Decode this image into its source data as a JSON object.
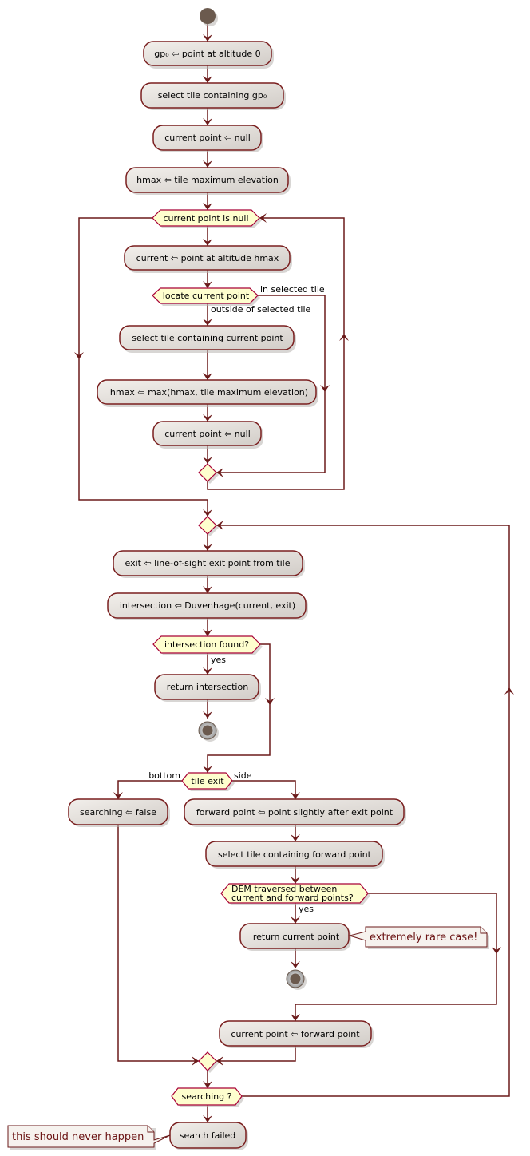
{
  "diagram": {
    "type": "activity",
    "colors": {
      "edge": "#6b1a1a",
      "activity_border": "#7a1f1f",
      "activity_fill_start": "#f2efeb",
      "activity_fill_end": "#d4cfca",
      "decision_fill": "#fefece",
      "decision_border": "#a80036",
      "start_fill": "#6b5a4e",
      "note_fill": "#f6f2ee",
      "note_text": "#6b1414"
    },
    "activities": {
      "a1": "gp₀ ⇦ point at altitude 0",
      "a2": "select tile containing gp₀",
      "a3": "current point ⇦ null",
      "a4": "hmax ⇦ tile maximum elevation",
      "a5": "current ⇦ point at altitude hmax",
      "a6": "select tile containing current point",
      "a7": "hmax ⇦ max(hmax, tile maximum elevation)",
      "a8": "current point ⇦ null",
      "a9": "exit ⇦ line-of-sight exit point from tile",
      "a10": "intersection ⇦ Duvenhage(current, exit)",
      "a11": "return intersection",
      "a12": "searching ⇦ false",
      "a13": "forward point ⇦ point slightly after exit point",
      "a14": "select tile containing forward point",
      "a15": "return current point",
      "a16": "current point ⇦ forward point",
      "a17": "search failed"
    },
    "decisions": {
      "d1": "current point is null",
      "d2": "locate current point",
      "d3": "intersection found?",
      "d4": "tile exit",
      "d5_line1": "DEM traversed between",
      "d5_line2": "current and forward points?",
      "d6": "searching ?"
    },
    "edge_labels": {
      "in_selected_tile": "in selected tile",
      "outside_selected_tile": "outside of selected tile",
      "yes1": "yes",
      "bottom": "bottom",
      "side": "side",
      "yes2": "yes"
    },
    "notes": {
      "n1": "extremely rare case!",
      "n2": "this should never happen"
    }
  }
}
